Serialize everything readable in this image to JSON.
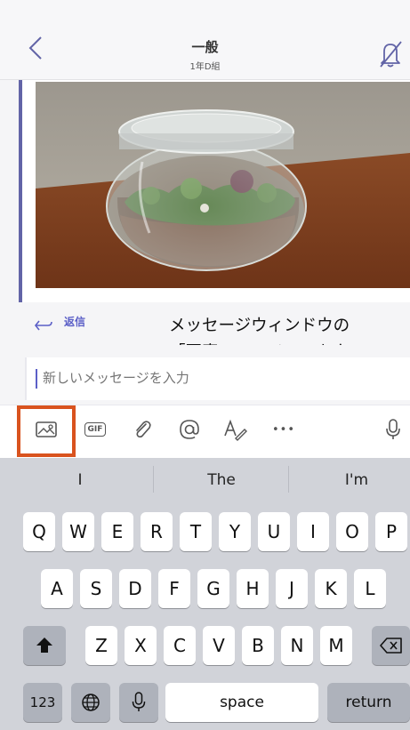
{
  "header": {
    "title": "一般",
    "subtitle": "1年D組"
  },
  "message": {
    "reply_label": "返信"
  },
  "annotation": {
    "line1": "メッセージウィンドウの",
    "line2": "「写真」のアイコンをタッ"
  },
  "compose": {
    "placeholder": "新しいメッセージを入力"
  },
  "toolbar": {
    "gif_label": "GIF",
    "more_label": "•••"
  },
  "keyboard": {
    "suggestions": [
      "I",
      "The",
      "I'm"
    ],
    "row1": [
      "Q",
      "W",
      "E",
      "R",
      "T",
      "Y",
      "U",
      "I",
      "O",
      "P"
    ],
    "row2": [
      "A",
      "S",
      "D",
      "F",
      "G",
      "H",
      "J",
      "K",
      "L"
    ],
    "row3": [
      "Z",
      "X",
      "C",
      "V",
      "B",
      "N",
      "M"
    ],
    "numbers_label": "123",
    "space_label": "space",
    "return_label": "return"
  },
  "colors": {
    "accent": "#6264a7",
    "highlight": "#d9531e",
    "keyboard_bg": "#d1d3d9"
  }
}
